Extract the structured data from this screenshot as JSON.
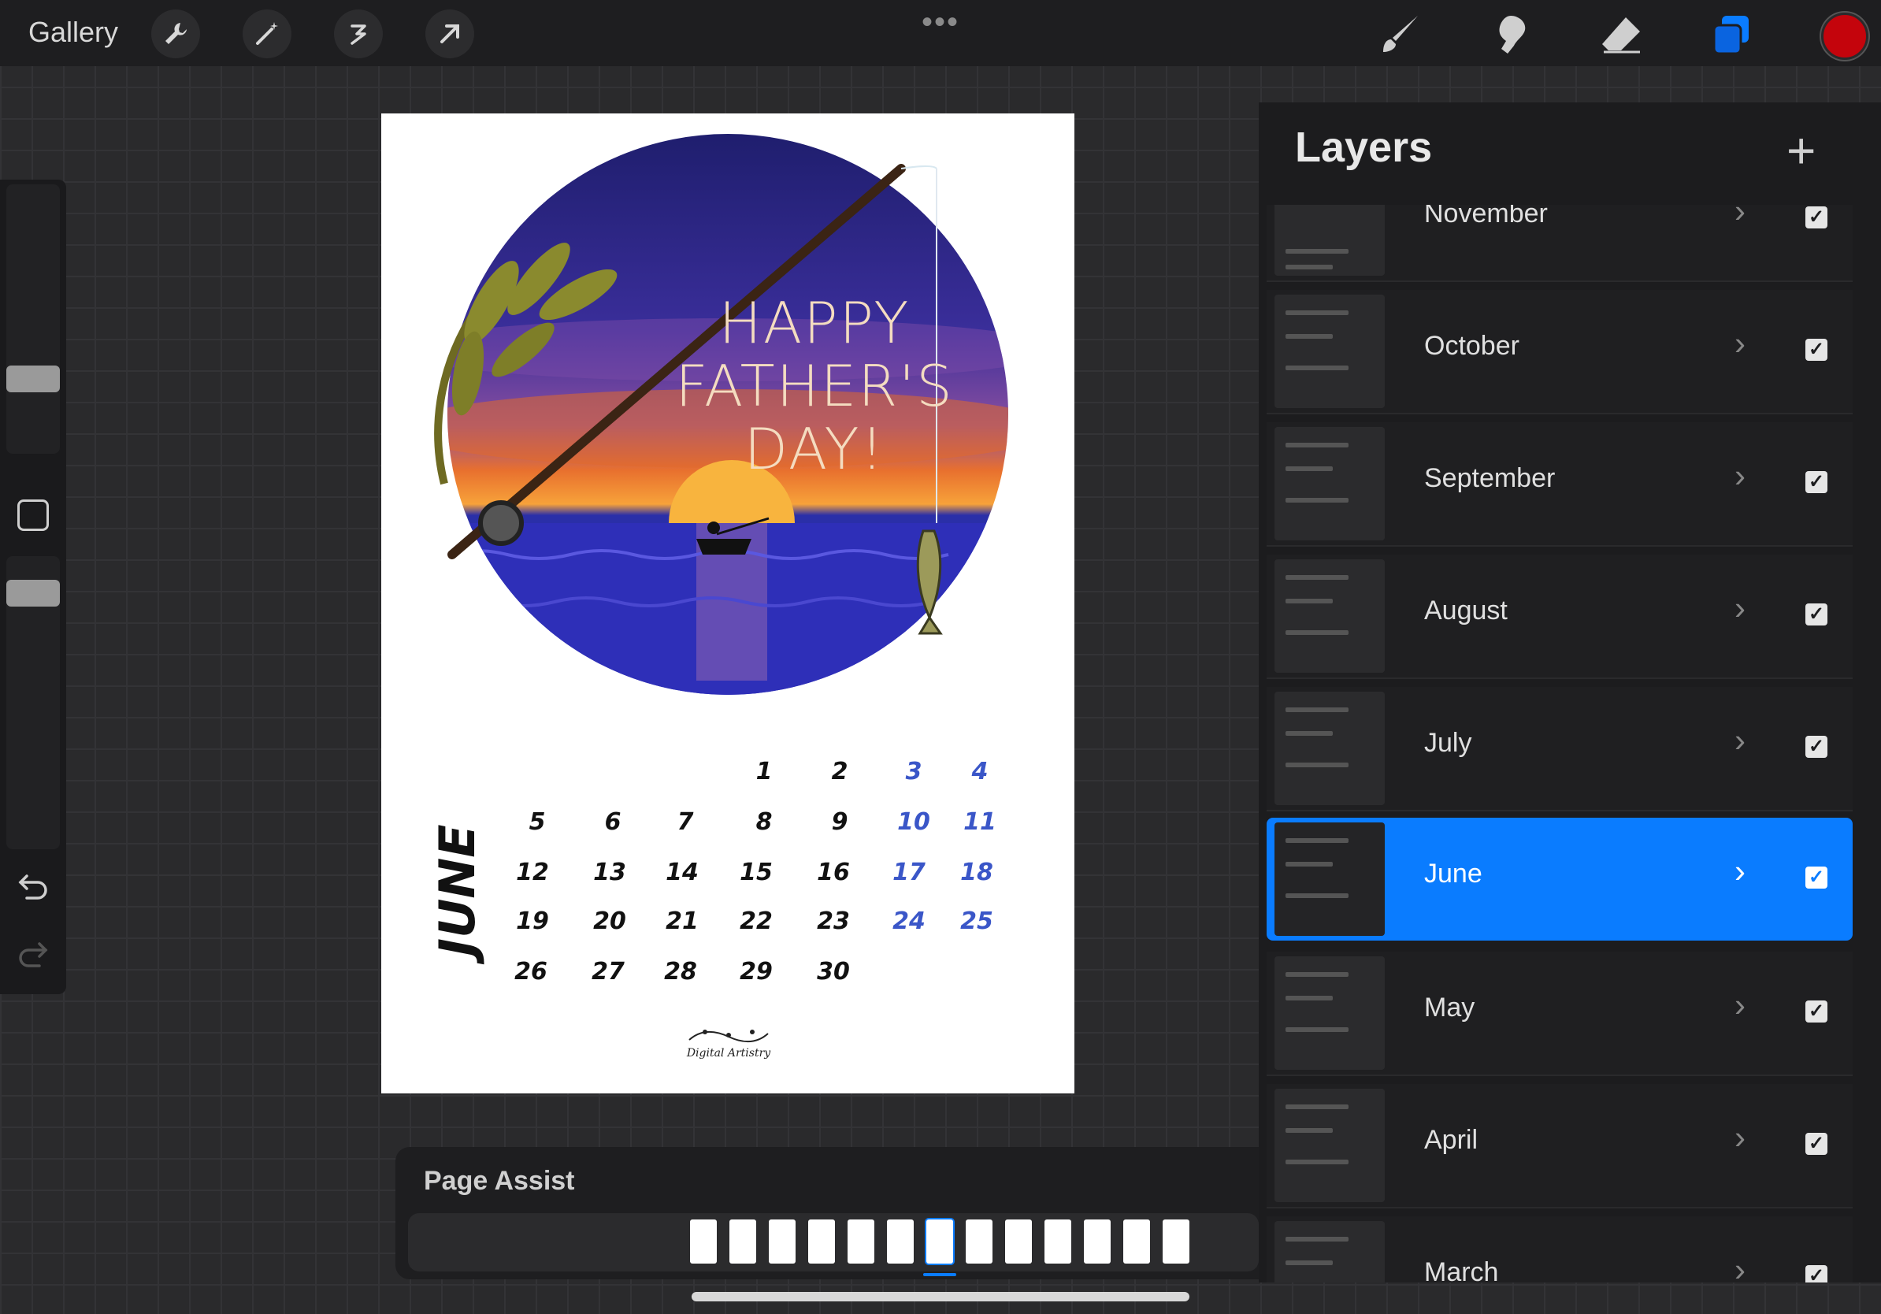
{
  "topbar": {
    "gallery_label": "Gallery",
    "left_tools": [
      "wrench-icon",
      "magic-wand-icon",
      "selection-icon",
      "transform-arrow-icon"
    ],
    "more_label": "•••",
    "right_tools": [
      "brush-icon",
      "smudge-icon",
      "eraser-icon",
      "layers-icon"
    ],
    "active_color": "#c4040c",
    "layers_accent": "#0a7cff"
  },
  "sidebar": {
    "modify_button_icon": "square-icon",
    "undo_icon": "undo-icon",
    "redo_icon": "redo-icon"
  },
  "canvas": {
    "greeting_lines": [
      "HAPPY",
      "FATHER'S",
      "DAY!"
    ],
    "month_label": "JUNE",
    "calendar": {
      "days": [
        "1",
        "2",
        "3",
        "4",
        "5",
        "6",
        "7",
        "8",
        "9",
        "10",
        "11",
        "12",
        "13",
        "14",
        "15",
        "16",
        "17",
        "18",
        "19",
        "20",
        "21",
        "22",
        "23",
        "24",
        "25",
        "26",
        "27",
        "28",
        "29",
        "30"
      ],
      "weekend_color": "#3a56c8"
    },
    "logo_text": "Digital Artistry"
  },
  "layers": {
    "title": "Layers",
    "add_label": "+",
    "items": [
      {
        "name": "November",
        "selected": false,
        "visible": true
      },
      {
        "name": "October",
        "selected": false,
        "visible": true
      },
      {
        "name": "September",
        "selected": false,
        "visible": true
      },
      {
        "name": "August",
        "selected": false,
        "visible": true
      },
      {
        "name": "July",
        "selected": false,
        "visible": true
      },
      {
        "name": "June",
        "selected": true,
        "visible": true
      },
      {
        "name": "May",
        "selected": false,
        "visible": true
      },
      {
        "name": "April",
        "selected": false,
        "visible": true
      },
      {
        "name": "March",
        "selected": false,
        "visible": true
      }
    ],
    "chevron": "›",
    "check": "✓"
  },
  "page_assist": {
    "title": "Page Assist",
    "page_count": 13,
    "active_page": 7
  }
}
